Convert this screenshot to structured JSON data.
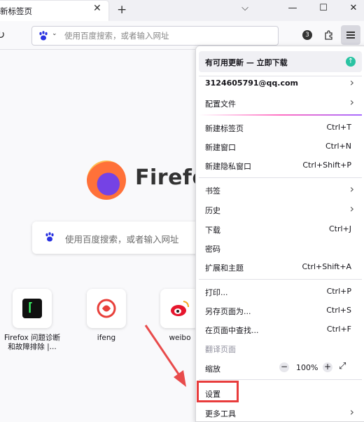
{
  "tab": {
    "title": "新标签页",
    "close_glyph": "✕",
    "new_tab_glyph": "+"
  },
  "window": {
    "list_tabs_glyph": "⌵",
    "minimize_glyph": "—",
    "maximize_glyph": "☐",
    "close_glyph": "✕"
  },
  "toolbar": {
    "reload_glyph": "↻",
    "url_placeholder": "使用百度搜索，或者输入网址",
    "extension_badge": "3",
    "extensions_icon": "puzzle-icon"
  },
  "newtab": {
    "brand": "Firefox",
    "search_placeholder": "使用百度搜索，或者输入网址",
    "tiles": [
      {
        "label": "Firefox 问题诊断和故障排除 |..."
      },
      {
        "label": "ifeng"
      },
      {
        "label": "weibo"
      }
    ]
  },
  "menu": {
    "update_label": "有可用更新 — 立即下载",
    "update_icon": "↑",
    "account": "3124605791@qq.com",
    "profiles": "配置文件",
    "new_tab": "新建标签页",
    "new_tab_key": "Ctrl+T",
    "new_window": "新建窗口",
    "new_window_key": "Ctrl+N",
    "private_window": "新建隐私窗口",
    "private_window_key": "Ctrl+Shift+P",
    "bookmarks": "书签",
    "history": "历史",
    "downloads": "下载",
    "downloads_key": "Ctrl+J",
    "passwords": "密码",
    "addons": "扩展和主题",
    "addons_key": "Ctrl+Shift+A",
    "print": "打印...",
    "print_key": "Ctrl+P",
    "save_page": "另存页面为...",
    "save_page_key": "Ctrl+S",
    "find": "在页面中查找...",
    "find_key": "Ctrl+F",
    "translate": "翻译页面",
    "zoom": "缩放",
    "zoom_value": "100%",
    "zoom_minus": "−",
    "zoom_plus": "+",
    "zoom_fullscreen": "⤢",
    "settings": "设置",
    "more_tools": "更多工具",
    "chevron": "›"
  },
  "colors": {
    "highlight": "#e83c3c",
    "update_dot": "#2ac3a2",
    "brand_text": "#333333"
  }
}
